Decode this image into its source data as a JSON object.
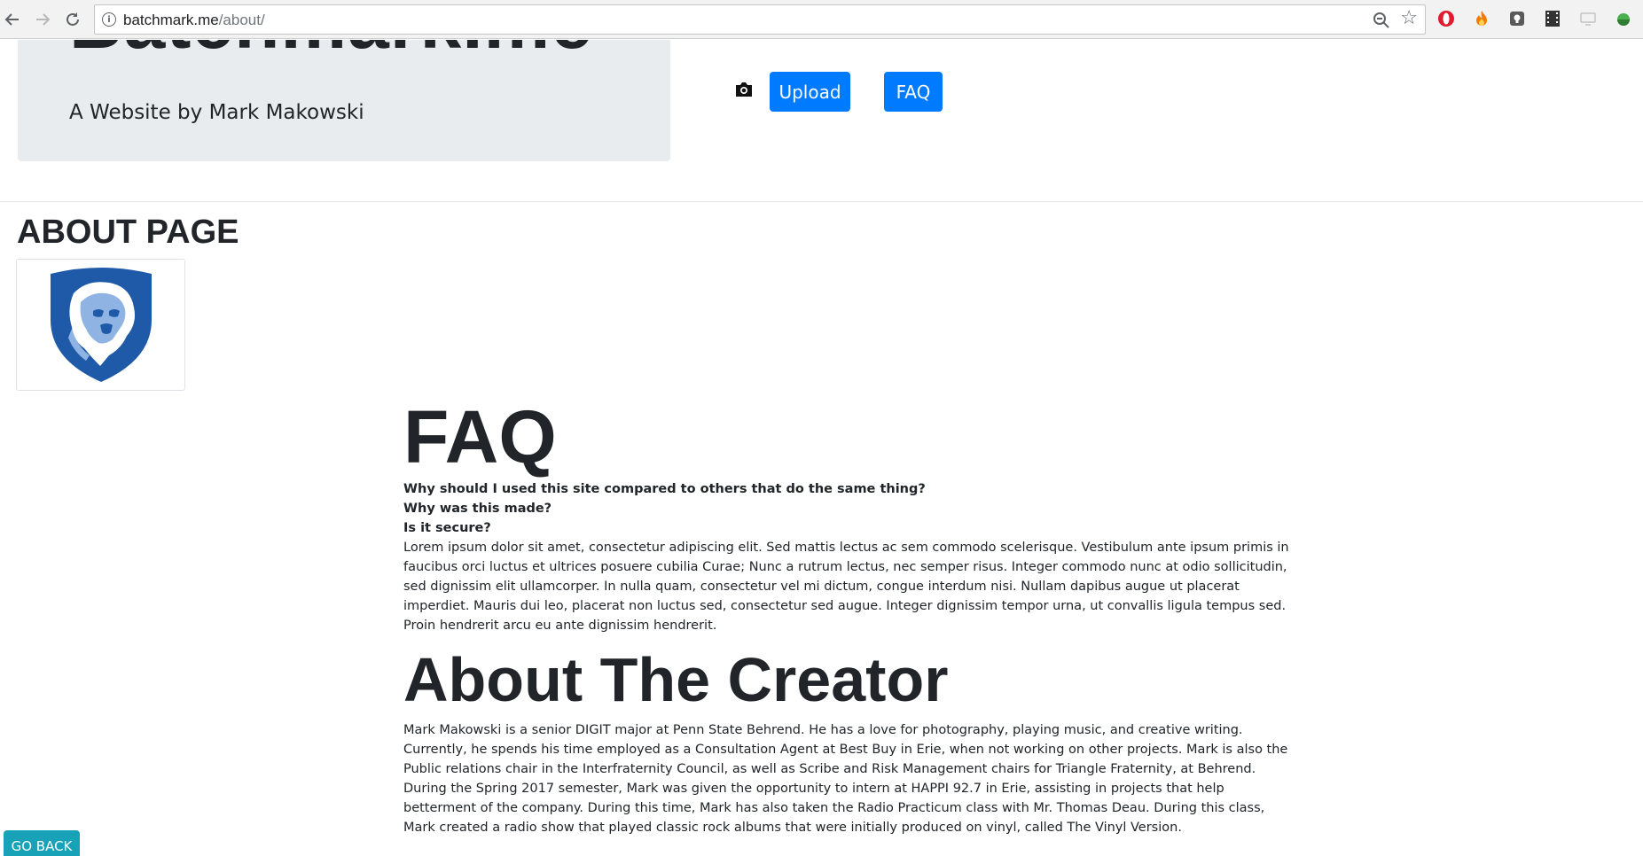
{
  "browser": {
    "url_host": "batchmark.me",
    "url_path": "/about/"
  },
  "header": {
    "brand": "Batchmark.me",
    "tagline": "A Website by Mark Makowski",
    "upload_label": "Upload",
    "faq_label": "FAQ"
  },
  "about": {
    "heading": "ABOUT PAGE"
  },
  "faq": {
    "title": "FAQ",
    "questions": [
      "Why should I used this site compared to others that do the same thing?",
      "Why was this made?",
      "Is it secure?"
    ],
    "answer": "Lorem ipsum dolor sit amet, consectetur adipiscing elit. Sed mattis lectus ac sem commodo scelerisque. Vestibulum ante ipsum primis in faucibus orci luctus et ultrices posuere cubilia Curae; Nunc a rutrum lectus, nec semper risus. Integer commodo nunc at odio sollicitudin, sed dignissim elit ullamcorper. In nulla quam, consectetur vel mi dictum, congue interdum nisi. Nullam dapibus augue ut placerat imperdiet. Mauris dui leo, placerat non luctus sed, consectetur sed augue. Integer dignissim tempor urna, ut convallis ligula tempus sed. Proin hendrerit arcu eu ante dignissim hendrerit."
  },
  "creator": {
    "title": "About The Creator",
    "bio": "Mark Makowski is a senior DIGIT major at Penn State Behrend. He has a love for photography, playing music, and creative writing. Currently, he spends his time employed as a Consultation Agent at Best Buy in Erie, when not working on other projects. Mark is also the Public relations chair in the Interfraternity Council, as well as Scribe and Risk Management chairs for Triangle Fraternity, at Behrend. During the Spring 2017 semester, Mark was given the opportunity to intern at HAPPI 92.7 in Erie, assisting in projects that help betterment of the company. During this time, Mark has also taken the Radio Practicum class with Mr. Thomas Deau. During this class, Mark created a radio show that played classic rock albums that were initially produced on vinyl, called The Vinyl Version."
  },
  "footer": {
    "go_back_label": "GO BACK"
  },
  "icons": {
    "back": "arrow-left-icon",
    "forward": "arrow-right-icon",
    "reload": "reload-icon",
    "info": "info-icon",
    "zoom": "zoom-icon",
    "bookmark": "star-icon",
    "camera": "camera-icon",
    "logo": "penn-state-lion-shield"
  },
  "colors": {
    "primary_button": "#007bff",
    "info_button": "#17a2b8",
    "jumbotron_bg": "#e9ecef",
    "shield_blue": "#1e5aa8"
  }
}
